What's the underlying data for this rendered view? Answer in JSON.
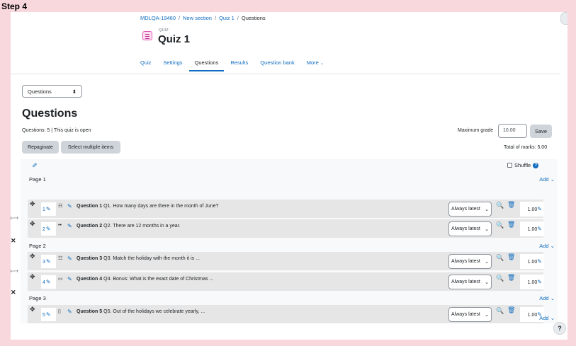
{
  "step_label": "Step 4",
  "breadcrumb": {
    "item1": "MDLQA-19460",
    "item2": "New section",
    "item3": "Quiz 1",
    "item4": "Questions",
    "sep": "/"
  },
  "header": {
    "module_type": "QUIZ",
    "title": "Quiz 1"
  },
  "tabs": [
    "Quiz",
    "Settings",
    "Questions",
    "Results",
    "Question bank",
    "More"
  ],
  "tab_more_chevron": "⌄",
  "select": {
    "value": "Questions",
    "chevron": "⬍"
  },
  "page_heading": "Questions",
  "quiz_info": "Questions: 5 | This quiz is open",
  "max_grade": {
    "label": "Maximum grade",
    "value": "10.00",
    "save_label": "Save"
  },
  "buttons": {
    "repaginate": "Repaginate",
    "select_multiple": "Select multiple items"
  },
  "total_marks": "Total of marks: 5.00",
  "shuffle_label": "Shuffle",
  "help_q": "?",
  "pages": [
    {
      "label": "Page 1",
      "add": "Add"
    },
    {
      "label": "Page 2",
      "add": "Add"
    },
    {
      "label": "Page 3",
      "add": "Add"
    }
  ],
  "final_add": "Add",
  "questions": [
    {
      "number": "1",
      "name": "Question 1",
      "text": "Q1. How many days are there in the month of June?",
      "version": "Always latest",
      "mark": "1.00",
      "type_icon": "☷"
    },
    {
      "number": "2",
      "name": "Question 2",
      "text": "Q2. There are 12 months in a year.",
      "version": "Always latest",
      "mark": "1.00",
      "type_icon": "••"
    },
    {
      "number": "3",
      "name": "Question 3",
      "text": "Q3. Match the holiday with the month it is ...",
      "version": "Always latest",
      "mark": "1.00",
      "type_icon": "☷"
    },
    {
      "number": "4",
      "name": "Question 4",
      "text": "Q4. Bonus: What is the exact date of Christmas ...",
      "version": "Always latest",
      "mark": "1.00",
      "type_icon": "▭"
    },
    {
      "number": "5",
      "name": "Question 5",
      "text": "Q5. Out of the holidays we celebrate yearly, ...",
      "version": "Always latest",
      "mark": "1.00",
      "type_icon": "▯"
    }
  ],
  "icons": {
    "move": "✥",
    "pencil": "✎",
    "preview": "🔍",
    "trash": "🗑",
    "repaginate": "⟝⟞",
    "remove": "✕",
    "chevron": "⌄"
  }
}
